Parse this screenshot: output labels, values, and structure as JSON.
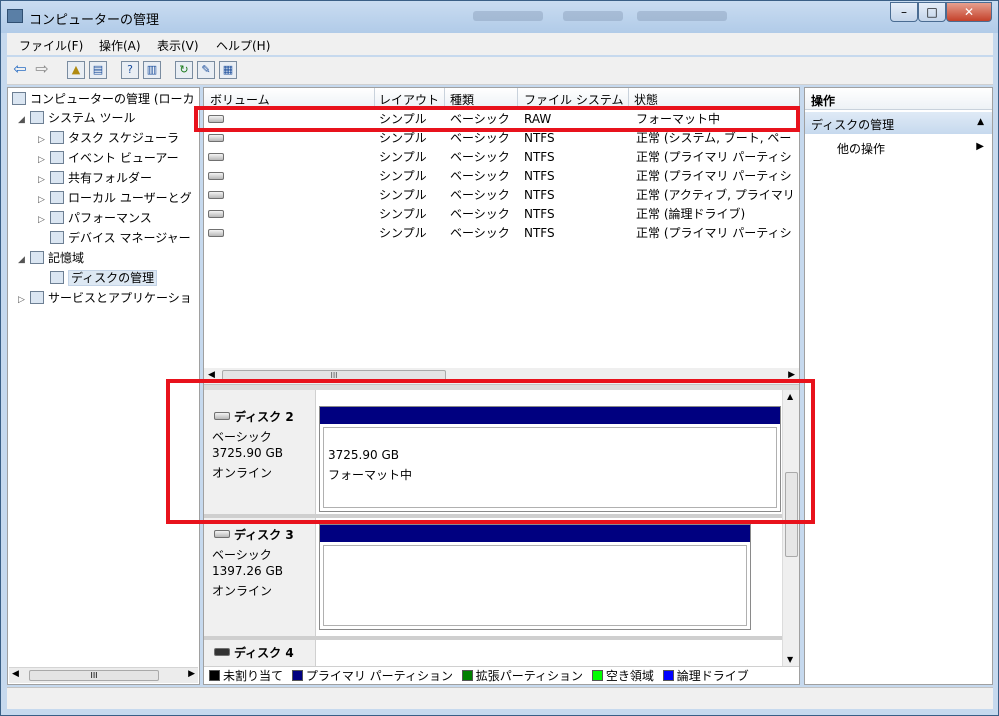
{
  "window": {
    "title": "コンピューターの管理",
    "blurred_title_text": [
      "Windows.bcc",
      "Ny [Loke]...",
      "シンプル ベーシック ..."
    ]
  },
  "menu": [
    "ファイル(F)",
    "操作(A)",
    "表示(V)",
    "ヘルプ(H)"
  ],
  "tree": {
    "root": "コンピューターの管理 (ローカ",
    "items": [
      {
        "label": "システム ツール",
        "icon": "tools-icon"
      },
      {
        "label": "タスク スケジューラ",
        "icon": "clock-icon"
      },
      {
        "label": "イベント ビューアー",
        "icon": "event-viewer-icon"
      },
      {
        "label": "共有フォルダー",
        "icon": "shared-folder-icon"
      },
      {
        "label": "ローカル ユーザーとグ",
        "icon": "users-icon"
      },
      {
        "label": "パフォーマンス",
        "icon": "performance-icon"
      },
      {
        "label": "デバイス マネージャー",
        "icon": "device-manager-icon"
      },
      {
        "label": "記憶域",
        "icon": "storage-icon"
      },
      {
        "label": "ディスクの管理",
        "icon": "disk-management-icon"
      },
      {
        "label": "サービスとアプリケーショ",
        "icon": "services-icon"
      }
    ],
    "scroll_grip": "III"
  },
  "volume_list": {
    "columns": [
      "ボリューム",
      "レイアウト",
      "種類",
      "ファイル システム",
      "状態"
    ],
    "rows": [
      [
        "",
        "シンプル",
        "ベーシック",
        "RAW",
        "フォーマット中"
      ],
      [
        "",
        "シンプル",
        "ベーシック",
        "NTFS",
        "正常 (システム, ブート, ペー"
      ],
      [
        "",
        "シンプル",
        "ベーシック",
        "NTFS",
        "正常 (プライマリ パーティシ"
      ],
      [
        "",
        "シンプル",
        "ベーシック",
        "NTFS",
        "正常 (プライマリ パーティシ"
      ],
      [
        "",
        "シンプル",
        "ベーシック",
        "NTFS",
        "正常 (アクティブ, プライマリ"
      ],
      [
        "",
        "シンプル",
        "ベーシック",
        "NTFS",
        "正常 (論理ドライブ)"
      ],
      [
        "",
        "シンプル",
        "ベーシック",
        "NTFS",
        "正常 (プライマリ パーティシ"
      ]
    ],
    "scroll_grip": "III"
  },
  "disks": [
    {
      "name": "ディスク 2",
      "type": "ベーシック",
      "size": "3725.90 GB",
      "status": "オンライン",
      "partition_size": "3725.90 GB",
      "partition_status": "フォーマット中"
    },
    {
      "name": "ディスク 3",
      "type": "ベーシック",
      "size": "1397.26 GB",
      "status": "オンライン",
      "partition_size": "",
      "partition_status": ""
    },
    {
      "name": "ディスク 4"
    }
  ],
  "legend": [
    {
      "label": "未割り当て",
      "color": "#000000"
    },
    {
      "label": "プライマリ パーティション",
      "color": "#000080"
    },
    {
      "label": "拡張パーティション",
      "color": "#008000"
    },
    {
      "label": "空き領域",
      "color": "#00ff00"
    },
    {
      "label": "論理ドライブ",
      "color": "#0000ff"
    }
  ],
  "actions": {
    "header": "操作",
    "section": "ディスクの管理",
    "sub": "他の操作"
  },
  "colors": {
    "highlight": "#e8121c",
    "primary_partition": "#000080"
  }
}
